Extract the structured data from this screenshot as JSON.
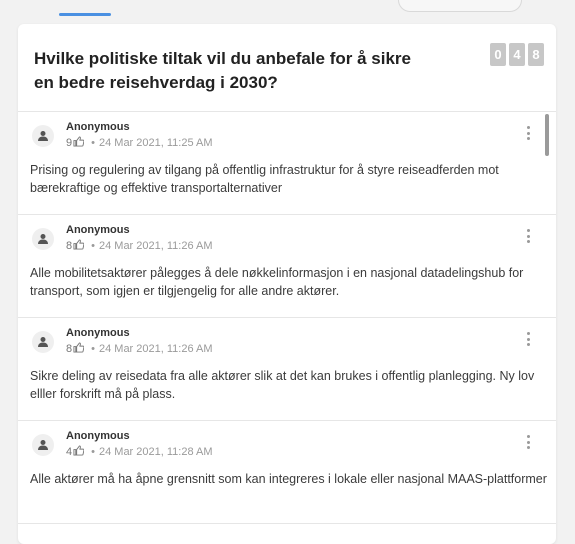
{
  "question": {
    "title": "Hvilke politiske tiltak vil du anbefale for å sikre en bedre reisehverdag i 2030?",
    "counter": [
      "0",
      "4",
      "8"
    ]
  },
  "responses": [
    {
      "author": "Anonymous",
      "likes": "9",
      "date": "24 Mar 2021, 11:25 AM",
      "text": "Prising og regulering av tilgang på offentlig infrastruktur for å styre reiseadferden mot bærekraftige og effektive transportalternativer"
    },
    {
      "author": "Anonymous",
      "likes": "8",
      "date": "24 Mar 2021, 11:26 AM",
      "text": "Alle mobilitetsaktører pålegges å dele nøkkelinformasjon i en nasjonal datadelingshub for transport, som igjen er tilgjengelig for alle andre aktører."
    },
    {
      "author": "Anonymous",
      "likes": "8",
      "date": "24 Mar 2021, 11:26 AM",
      "text": "Sikre deling av reisedata fra alle aktører slik at det kan brukes i offentlig planlegging. Ny lov elller forskrift må på plass."
    },
    {
      "author": "Anonymous",
      "likes": "4",
      "date": "24 Mar 2021, 11:28 AM",
      "text": "Alle aktører må ha åpne grensnitt som kan integreres i lokale eller nasjonal MAAS-plattformer"
    }
  ],
  "icons": {
    "avatar": "person-icon",
    "like": "thumb-up-icon",
    "menu": "more-vertical-icon"
  },
  "colors": {
    "accent": "#4a90e2",
    "counter_bg": "#c7c7c7"
  }
}
